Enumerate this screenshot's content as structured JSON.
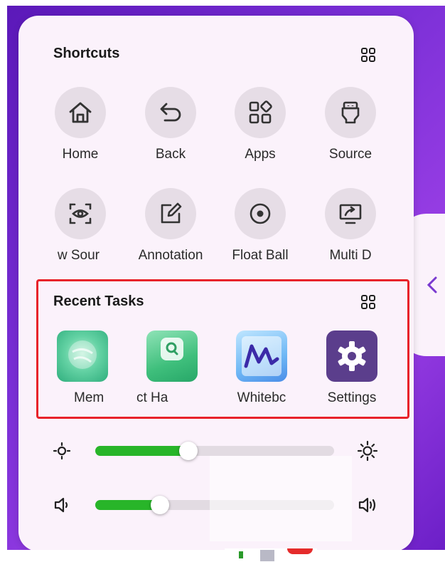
{
  "shortcuts": {
    "title": "Shortcuts",
    "items": [
      {
        "label": "Home",
        "icon": "home-icon"
      },
      {
        "label": "Back",
        "icon": "back-icon"
      },
      {
        "label": "Apps",
        "icon": "apps-icon"
      },
      {
        "label": "Source",
        "icon": "source-icon"
      },
      {
        "label": "w     Sour",
        "icon": "screen-view-icon"
      },
      {
        "label": "Annotation",
        "icon": "annotation-icon"
      },
      {
        "label": "Float Ball",
        "icon": "float-ball-icon"
      },
      {
        "label": "Multi D",
        "icon": "multi-display-icon"
      }
    ]
  },
  "recent_tasks": {
    "title": "Recent Tasks",
    "items": [
      {
        "label": "Mem",
        "icon": "memo-app-icon"
      },
      {
        "label": "ct   Ha",
        "icon": "search-app-icon"
      },
      {
        "label": "Whitebc",
        "icon": "whiteboard-app-icon"
      },
      {
        "label": "Settings",
        "icon": "settings-app-icon"
      }
    ]
  },
  "brightness": {
    "value": 0.39,
    "icon_low": "brightness-low-icon",
    "icon_high": "brightness-high-icon"
  },
  "volume": {
    "value": 0.27,
    "icon_low": "volume-low-icon",
    "icon_high": "volume-high-icon"
  },
  "colors": {
    "accent": "#28b529",
    "highlight": "#e8232a",
    "panel": "#fbf2fb",
    "circle": "#e6dde6",
    "settings_bg": "#5b3e8c"
  }
}
